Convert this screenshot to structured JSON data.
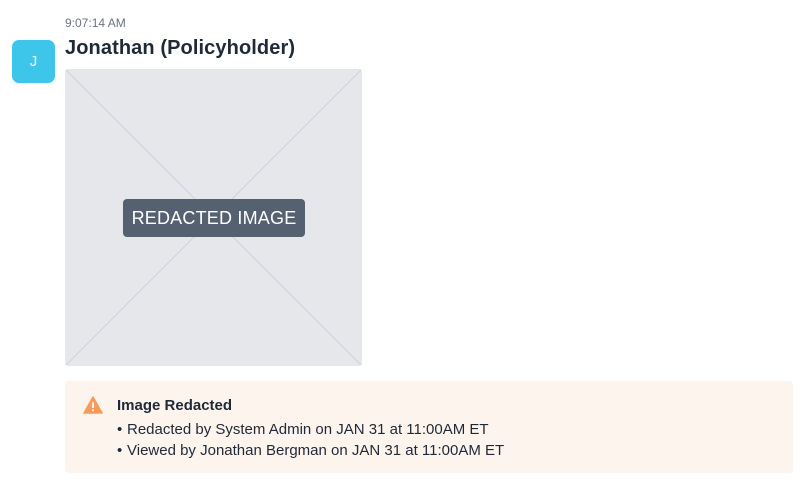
{
  "message": {
    "timestamp": "9:07:14 AM",
    "avatar_initial": "J",
    "sender": "Jonathan (Policyholder)",
    "image": {
      "label": "REDACTED IMAGE"
    }
  },
  "notice": {
    "icon": "warning-triangle-icon",
    "title": "Image Redacted",
    "items": [
      "Redacted by System Admin on JAN 31 at 11:00AM ET",
      "Viewed by Jonathan Bergman on JAN 31 at 11:00AM ET"
    ]
  },
  "colors": {
    "avatar": "#3ec6ea",
    "placeholder_bg": "#e5e7eb",
    "label_bg": "#556170",
    "notice_bg": "#fef4ee",
    "warning": "#f79a5a"
  }
}
